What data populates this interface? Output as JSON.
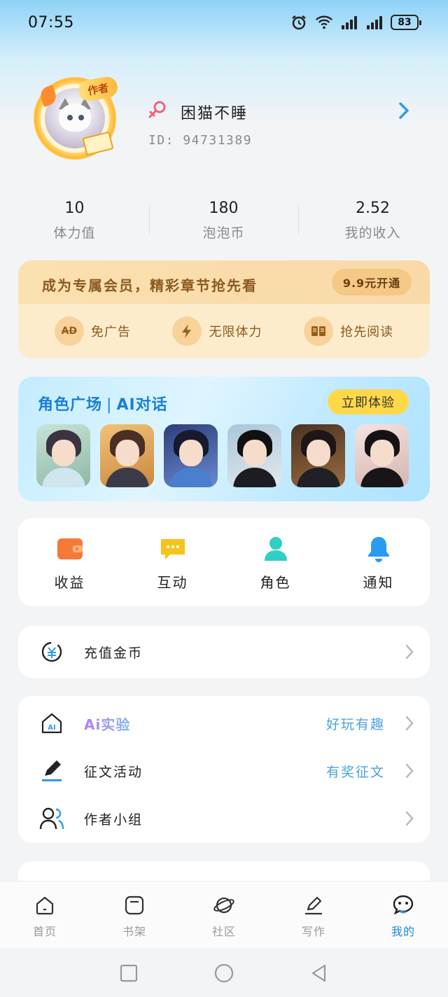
{
  "status_bar": {
    "time": "07:55",
    "battery": "83"
  },
  "profile": {
    "avatar_badge": "作者",
    "username": "困猫不睡",
    "user_id": "ID: 94731389"
  },
  "stats": [
    {
      "value": "10",
      "label": "体力值"
    },
    {
      "value": "180",
      "label": "泡泡币"
    },
    {
      "value": "2.52",
      "label": "我的收入"
    }
  ],
  "vip": {
    "title": "成为专属会员，精彩章节抢先看",
    "button": "9.9元开通",
    "features": [
      {
        "icon": "ad-icon",
        "icon_text": "AD",
        "label": "免广告"
      },
      {
        "icon": "lightning-icon",
        "icon_text": "",
        "label": "无限体力"
      },
      {
        "icon": "book-icon",
        "icon_text": "",
        "label": "抢先阅读"
      }
    ]
  },
  "character": {
    "title_left": "角色广场",
    "title_right": "AI对话",
    "button": "立即体验",
    "avatar_count_shown": 6
  },
  "quick_actions": [
    {
      "icon": "wallet-icon",
      "label": "收益",
      "color": "#f47a3a"
    },
    {
      "icon": "chat-bubble-icon",
      "label": "互动",
      "color": "#f7c21a"
    },
    {
      "icon": "person-icon",
      "label": "角色",
      "color": "#2ecfc4"
    },
    {
      "icon": "bell-icon",
      "label": "通知",
      "color": "#2a9cf0"
    }
  ],
  "recharge": {
    "label": "充值金币"
  },
  "list": [
    {
      "icon": "ai-house-icon",
      "label": "Ai实验",
      "right": "好玩有趣"
    },
    {
      "icon": "pen-icon",
      "label": "征文活动",
      "right": "有奖征文"
    },
    {
      "icon": "group-icon",
      "label": "作者小组",
      "right": ""
    }
  ],
  "tabs": [
    {
      "icon": "home-icon",
      "label": "首页",
      "active": false
    },
    {
      "icon": "bookshelf-icon",
      "label": "书架",
      "active": false
    },
    {
      "icon": "planet-icon",
      "label": "社区",
      "active": false
    },
    {
      "icon": "write-icon",
      "label": "写作",
      "active": false
    },
    {
      "icon": "mine-icon",
      "label": "我的",
      "active": true
    }
  ],
  "colors": {
    "accent": "#1e88d8",
    "link": "#4aa3e0",
    "vip_text": "#8a5a20"
  }
}
